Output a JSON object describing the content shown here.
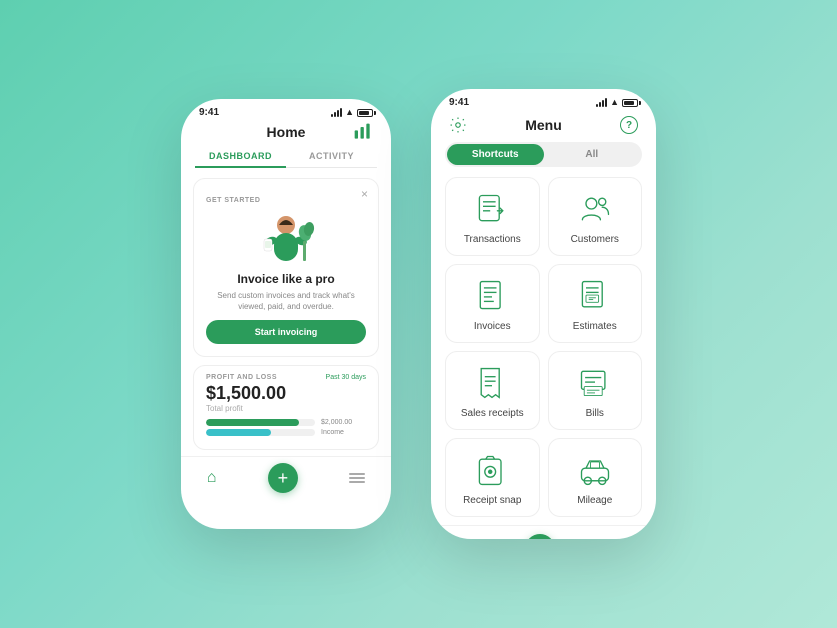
{
  "left_phone": {
    "status_time": "9:41",
    "header_title": "Home",
    "tab_dashboard": "DASHBOARD",
    "tab_activity": "ACTIVITY",
    "get_started_label": "GET STARTED",
    "card_title": "Invoice like a pro",
    "card_desc": "Send custom invoices and track what's viewed, paid, and overdue.",
    "start_btn": "Start invoicing",
    "pnl_label": "PROFIT AND LOSS",
    "pnl_period": "Past 30 days",
    "pnl_amount": "$1,500.00",
    "pnl_sublabel": "Total profit",
    "income_value": "$2,000.00",
    "income_label": "Income"
  },
  "right_phone": {
    "status_time": "9:41",
    "menu_title": "Menu",
    "shortcuts_label": "Shortcuts",
    "all_label": "All",
    "cells": [
      {
        "label": "Transactions",
        "icon": "transactions"
      },
      {
        "label": "Customers",
        "icon": "customers"
      },
      {
        "label": "Invoices",
        "icon": "invoices"
      },
      {
        "label": "Estimates",
        "icon": "estimates"
      },
      {
        "label": "Sales receipts",
        "icon": "sales-receipts"
      },
      {
        "label": "Bills",
        "icon": "bills"
      },
      {
        "label": "Receipt snap",
        "icon": "receipt-snap"
      },
      {
        "label": "Mileage",
        "icon": "mileage"
      }
    ]
  },
  "colors": {
    "green": "#2b9c5b",
    "teal": "#39c0c8",
    "bg_gradient_start": "#5ecfb0",
    "bg_gradient_end": "#b0e8d8"
  }
}
